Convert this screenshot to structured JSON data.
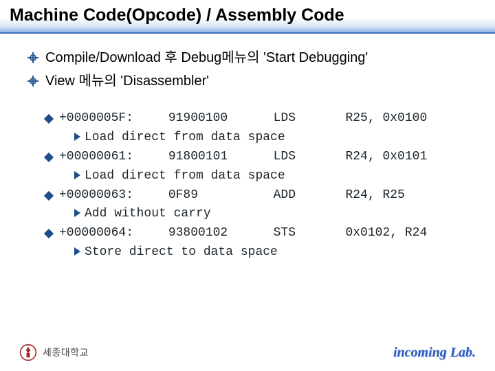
{
  "title": "Machine Code(Opcode) / Assembly Code",
  "bullet_points": [
    "Compile/Download 후 Debug메뉴의 'Start Debugging'",
    "View 메뉴의 'Disassembler'"
  ],
  "disasm": [
    {
      "address": "+0000005F:",
      "opcode": "91900100",
      "mnemonic": "LDS",
      "operands": "R25, 0x0100",
      "desc": "Load direct from data space"
    },
    {
      "address": "+00000061:",
      "opcode": "91800101",
      "mnemonic": "LDS",
      "operands": "R24, 0x0101",
      "desc": "Load direct from data space"
    },
    {
      "address": "+00000063:",
      "opcode": "0F89",
      "mnemonic": "ADD",
      "operands": "R24, R25",
      "desc": "Add without carry"
    },
    {
      "address": "+00000064:",
      "opcode": "93800102",
      "mnemonic": "STS",
      "operands": "0x0102, R24",
      "desc": "Store direct to data space"
    }
  ],
  "footer": {
    "university": "세종대학교",
    "lab": "incoming Lab."
  }
}
